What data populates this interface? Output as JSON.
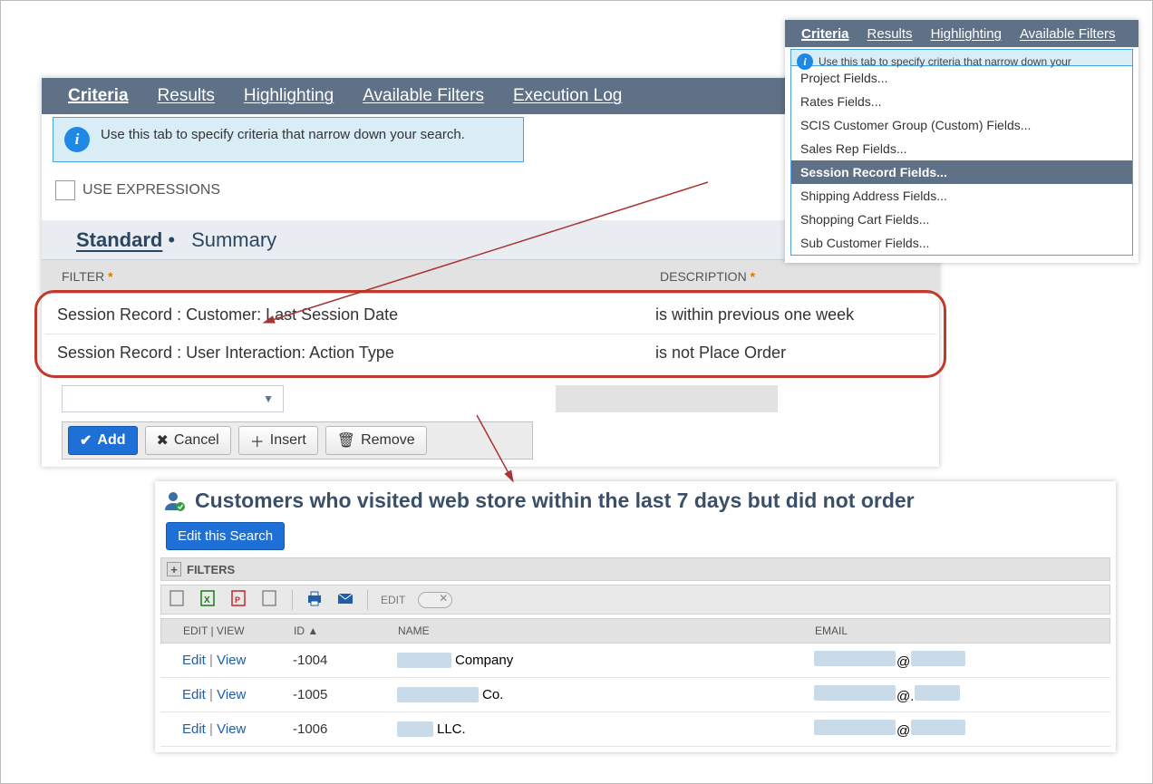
{
  "tabs": {
    "criteria": "Criteria",
    "results": "Results",
    "highlighting": "Highlighting",
    "available_filters": "Available Filters",
    "execution_log": "Execution Log"
  },
  "info_tip": "Use this tab to specify criteria that narrow down your search.",
  "use_expressions_label": "USE EXPRESSIONS",
  "subtabs": {
    "standard": "Standard",
    "summary": "Summary"
  },
  "columns": {
    "filter": "FILTER",
    "description": "DESCRIPTION"
  },
  "filters": [
    {
      "filter": "Session Record : Customer: Last Session Date",
      "description": "is within previous one week"
    },
    {
      "filter": "Session Record : User Interaction: Action Type",
      "description": "is not Place Order"
    }
  ],
  "buttons": {
    "add": "Add",
    "cancel": "Cancel",
    "insert": "Insert",
    "remove": "Remove"
  },
  "dropdown_panel": {
    "info_tip_short": "Use this tab to specify criteria that narrow down your",
    "items": [
      "Project Fields...",
      "Rates Fields...",
      "SCIS Customer Group (Custom) Fields...",
      "Sales Rep Fields...",
      "Session Record Fields...",
      "Shipping Address Fields...",
      "Shopping Cart Fields...",
      "Sub Customer Fields..."
    ],
    "selected_index": 4
  },
  "results_panel": {
    "title": "Customers who visited web store within the last 7 days but did not order",
    "edit_button": "Edit this Search",
    "filters_label": "FILTERS",
    "edit_toggle_label": "EDIT",
    "columns": {
      "edit_view": "EDIT | VIEW",
      "id": "ID",
      "name": "NAME",
      "email": "EMAIL"
    },
    "link_edit": "Edit",
    "link_view": "View",
    "rows": [
      {
        "id": "-1004",
        "name_suffix": "Company",
        "email_at": "@"
      },
      {
        "id": "-1005",
        "name_suffix": "Co.",
        "email_at": "@."
      },
      {
        "id": "-1006",
        "name_suffix": "LLC.",
        "email_at": "@"
      }
    ]
  }
}
